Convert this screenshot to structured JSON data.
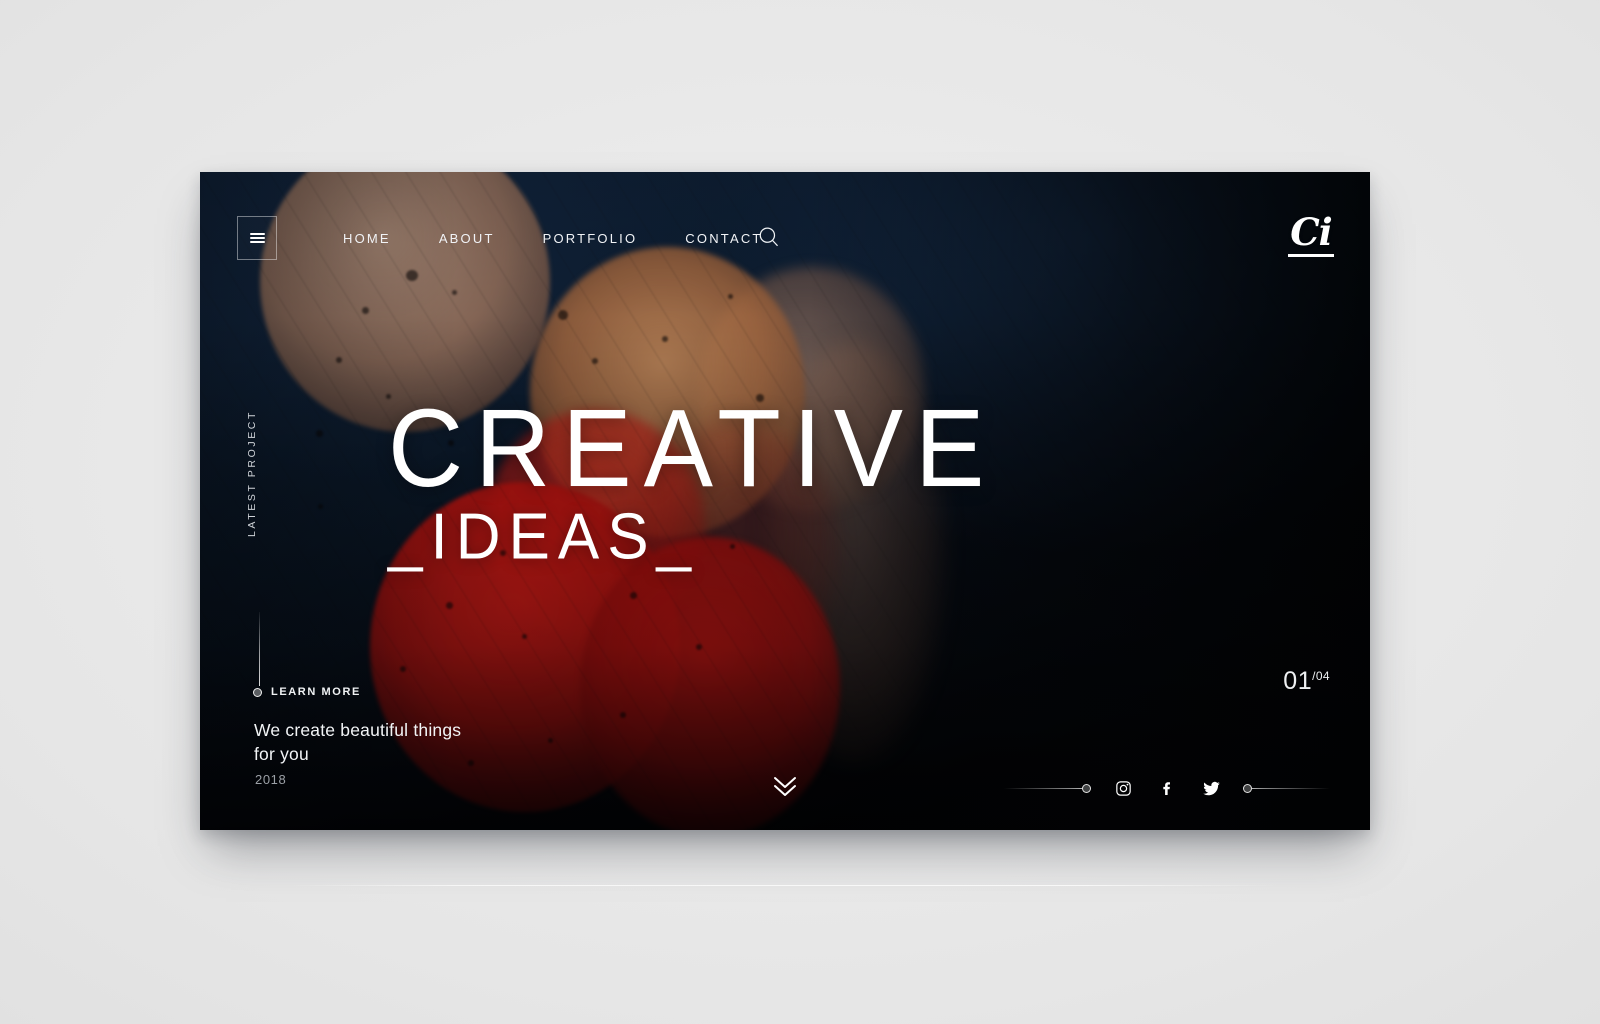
{
  "nav": {
    "menu_icon": "hamburger-icon",
    "items": [
      {
        "label": "HOME"
      },
      {
        "label": "ABOUT"
      },
      {
        "label": "PORTFOLIO"
      },
      {
        "label": "CONTACT"
      }
    ],
    "search_icon": "search-icon"
  },
  "logo": {
    "text": "Ci"
  },
  "hero": {
    "side_label": "LATEST PROJECT",
    "title_line1": "CREATIVE",
    "title_line2": "_IDEAS_",
    "learn_more": "LEARN MORE",
    "tagline": "We create beautiful things for you",
    "year": "2018"
  },
  "pagination": {
    "current": "01",
    "total": "/04"
  },
  "scroll": {
    "icon": "chevron-double-down-icon"
  },
  "social": [
    {
      "name": "instagram",
      "label": "Instagram"
    },
    {
      "name": "facebook",
      "label": "Facebook"
    },
    {
      "name": "twitter",
      "label": "Twitter"
    }
  ],
  "colors": {
    "page_bg": "#ebebeb",
    "hero_navy": "#0e2037",
    "hero_black": "#040608",
    "bokeh_red": "#d81c16",
    "bokeh_wood": "#a6683e",
    "text": "#ffffff",
    "muted": "#9ba0a6"
  }
}
